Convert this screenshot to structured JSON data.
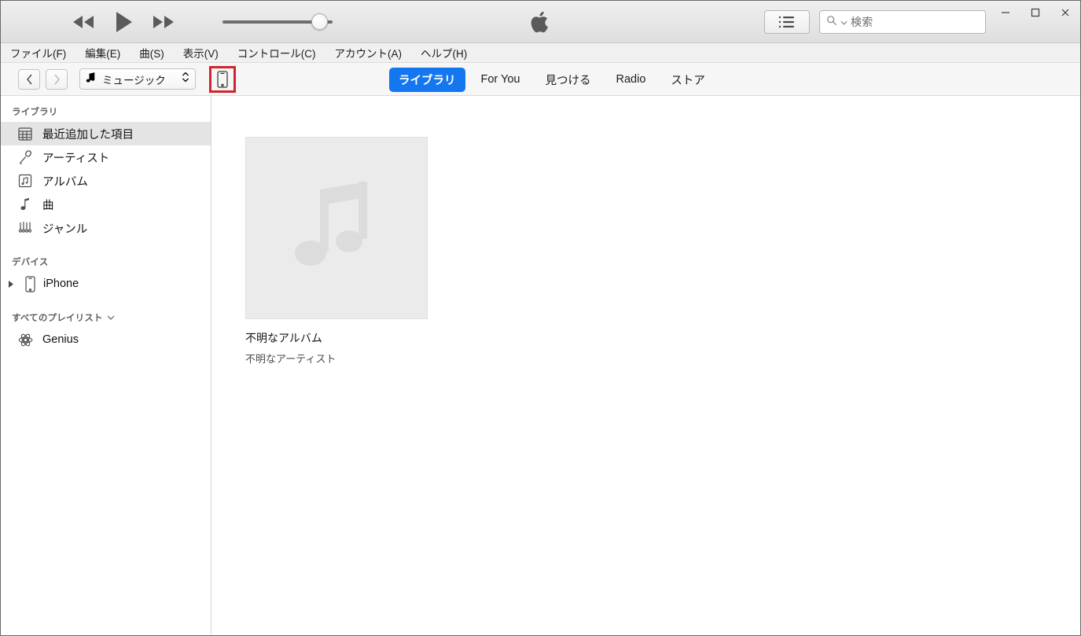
{
  "window": {
    "controls": {
      "minimize": "–",
      "maximize": "□",
      "close": "✕"
    }
  },
  "transport": {
    "rewind_label": "巻き戻し",
    "play_label": "再生",
    "fastforward_label": "早送り",
    "volume_value": 85,
    "apple_logo_label": "Apple"
  },
  "toolbar": {
    "queue_label": "次はこちら",
    "search": {
      "placeholder": "検索",
      "value": ""
    }
  },
  "menubar": {
    "items": [
      {
        "label": "ファイル(F)"
      },
      {
        "label": "編集(E)"
      },
      {
        "label": "曲(S)"
      },
      {
        "label": "表示(V)"
      },
      {
        "label": "コントロール(C)"
      },
      {
        "label": "アカウント(A)"
      },
      {
        "label": "ヘルプ(H)"
      }
    ]
  },
  "navbar": {
    "back_label": "戻る",
    "forward_label": "進む",
    "media_picker": {
      "value": "ミュージック"
    },
    "device_button": {
      "label": "iPhone",
      "highlighted": true,
      "highlight_color": "#d3242c"
    },
    "tabs": [
      {
        "label": "ライブラリ",
        "active": true
      },
      {
        "label": "For You",
        "active": false
      },
      {
        "label": "見つける",
        "active": false
      },
      {
        "label": "Radio",
        "active": false
      },
      {
        "label": "ストア",
        "active": false
      }
    ],
    "active_tab_color": "#1477ef"
  },
  "sidebar": {
    "library_header": "ライブラリ",
    "library_items": [
      {
        "label": "最近追加した項目",
        "icon": "grid-icon",
        "selected": true
      },
      {
        "label": "アーティスト",
        "icon": "microphone-icon",
        "selected": false
      },
      {
        "label": "アルバム",
        "icon": "album-icon",
        "selected": false
      },
      {
        "label": "曲",
        "icon": "music-note-icon",
        "selected": false
      },
      {
        "label": "ジャンル",
        "icon": "genre-icon",
        "selected": false
      }
    ],
    "devices_header": "デバイス",
    "devices": [
      {
        "label": "iPhone",
        "icon": "iphone-icon"
      }
    ],
    "playlists_header": "すべてのプレイリスト",
    "playlists": [
      {
        "label": "Genius",
        "icon": "genius-atom-icon"
      }
    ],
    "selected_bg": "#e4e4e4"
  },
  "content": {
    "albums": [
      {
        "title": "不明なアルバム",
        "artist": "不明なアーティスト",
        "artwork": "music-note-placeholder"
      }
    ]
  }
}
